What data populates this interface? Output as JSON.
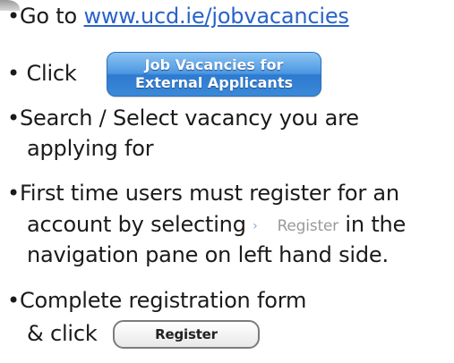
{
  "steps": {
    "go_to": {
      "prefix": "Go to",
      "url": "www.ucd.ie/jobvacancies"
    },
    "click_label": "Click",
    "job_button": {
      "line1": "Job Vacancies for",
      "line2": "External Applicants"
    },
    "search": {
      "line1": "Search / Select vacancy you are",
      "line2": "applying for"
    },
    "register": {
      "line1": "First time users must register for an",
      "line2_prefix": "account by selecting",
      "nav_label": "Register",
      "line2_suffix": "in the",
      "line3": "navigation pane on left hand side."
    },
    "complete": {
      "line1": "Complete registration form",
      "line2_prefix": "& click",
      "button_label": "Register"
    }
  },
  "colors": {
    "link": "#2a63c8",
    "button_blue": "#3b8ad8"
  }
}
